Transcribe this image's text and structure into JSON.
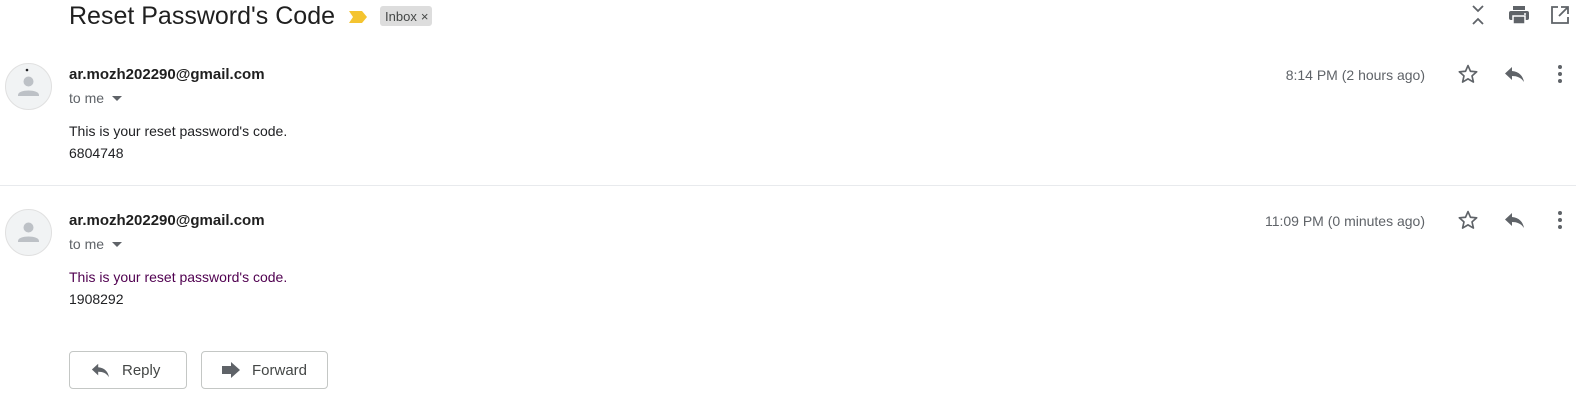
{
  "thread": {
    "subject": "Reset Password's Code",
    "label": "Inbox",
    "label_remove": "×",
    "importance_marker_color": "#f4c430"
  },
  "top_actions": {
    "icons": [
      "collapse-all-icon",
      "print-icon",
      "open-in-new-window-icon"
    ]
  },
  "messages": [
    {
      "sender": "ar.mozh202290@gmail.com",
      "recipient": "to me",
      "timestamp": "8:14 PM (2 hours ago)",
      "body_line1": "This is your reset password's code.",
      "body_line2": "6804748"
    },
    {
      "sender": "ar.mozh202290@gmail.com",
      "recipient": "to me",
      "timestamp": "11:09 PM (0 minutes ago)",
      "body_line1": "This is your reset password's code.",
      "body_line2": "1908292",
      "body_line1_color": "#500050"
    }
  ],
  "message_actions": {
    "icons": [
      "star-icon",
      "reply-icon",
      "more-vert-icon"
    ]
  },
  "reply_bar": {
    "reply_label": "Reply",
    "forward_label": "Forward"
  },
  "colors": {
    "text_primary": "#1f1f1f",
    "text_secondary": "#5f6368",
    "chip_bg": "#dddddd",
    "divider": "#e8eaed"
  }
}
